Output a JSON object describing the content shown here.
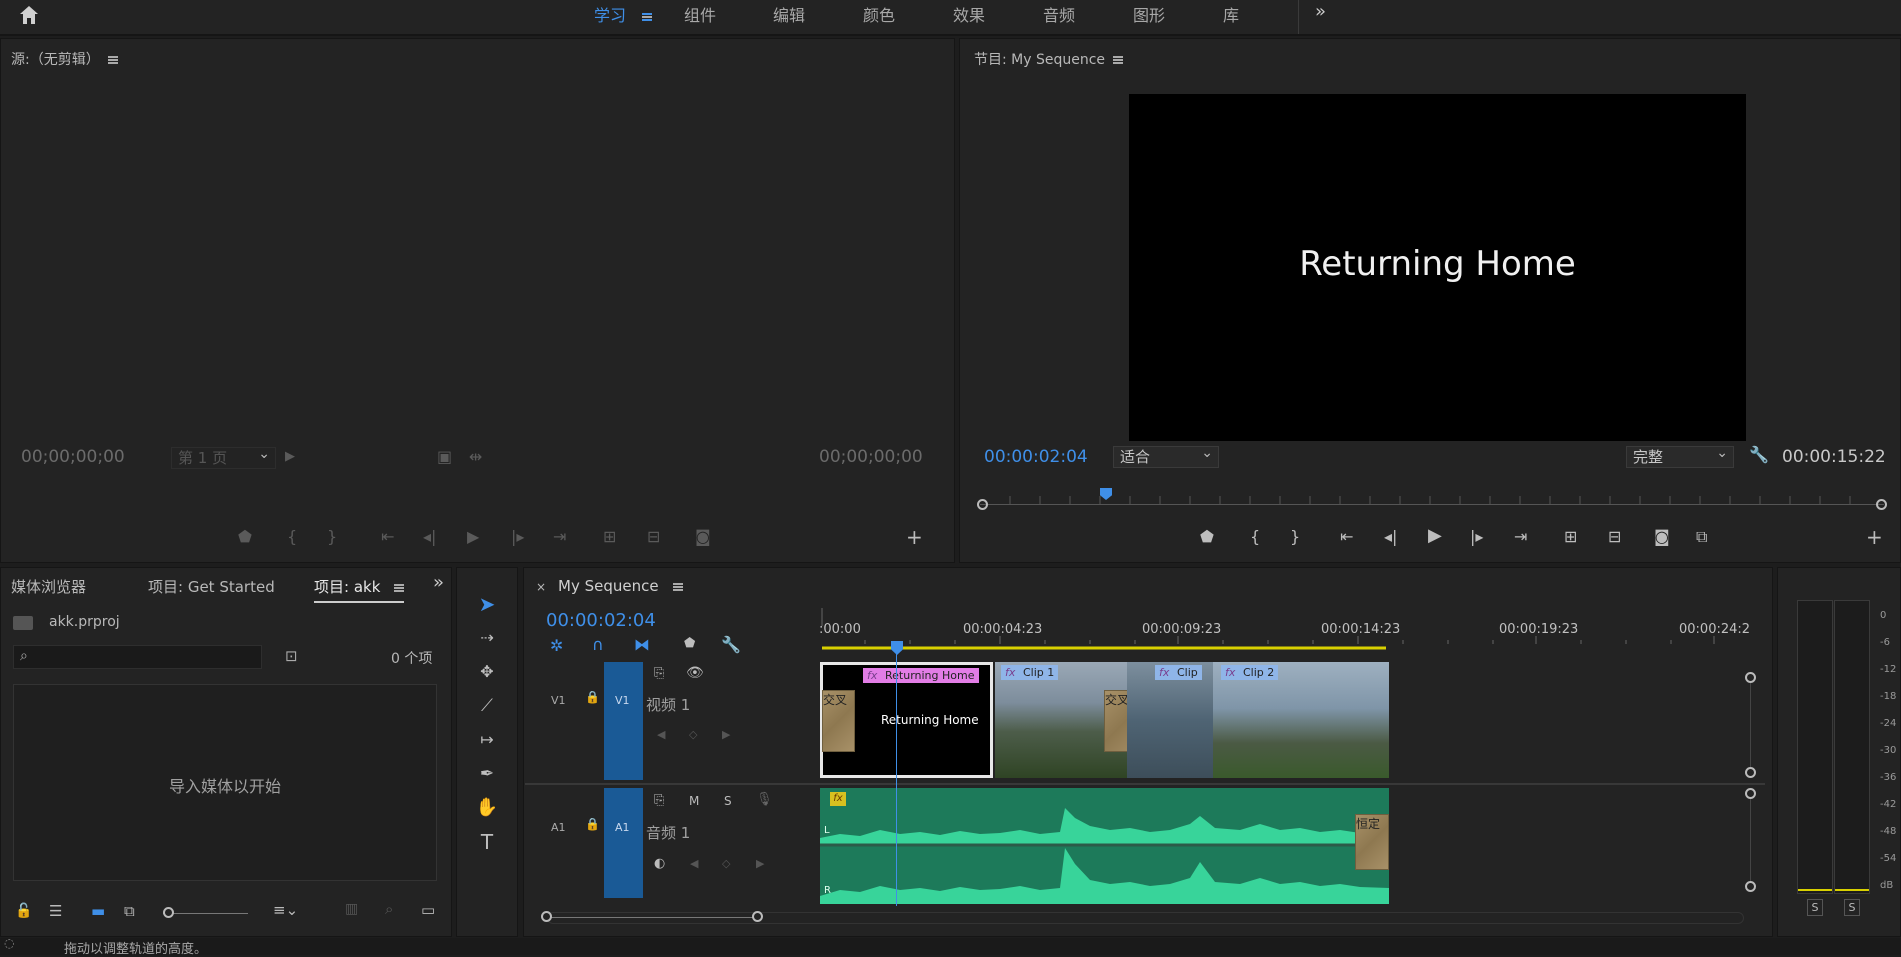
{
  "workspaces": [
    "学习",
    "组件",
    "编辑",
    "颜色",
    "效果",
    "音频",
    "图形",
    "库"
  ],
  "active_workspace": "学习",
  "source": {
    "title": "源:（无剪辑）",
    "tc_left": "00;00;00;00",
    "tc_right": "00;00;00;00",
    "page_select": "第 1 页"
  },
  "program": {
    "title": "节目: My Sequence",
    "title_card": "Returning Home",
    "tc_current": "00:00:02:04",
    "fit": "适合",
    "quality": "完整",
    "tc_duration": "00:00:15:22"
  },
  "project": {
    "tabs": [
      "媒体浏览器",
      "项目: Get Started",
      "项目: akk"
    ],
    "file": "akk.prproj",
    "item_count": "0 个项",
    "empty_hint": "导入媒体以开始"
  },
  "timeline": {
    "tab": "My Sequence",
    "tc": "00:00:02:04",
    "ruler": [
      ":00:00",
      "00:00:04:23",
      "00:00:09:23",
      "00:00:14:23",
      "00:00:19:23",
      "00:00:24:2"
    ],
    "video_track": {
      "id": "V1",
      "name": "视频 1"
    },
    "audio_track": {
      "id": "A1",
      "name": "音频 1",
      "m": "M",
      "s": "S"
    },
    "clips": [
      {
        "label": "Returning Home",
        "color": "#e27de6"
      },
      {
        "label": "Clip 1",
        "color": "#8fb5e8"
      },
      {
        "label": "Clip",
        "color": "#8fb5e8"
      },
      {
        "label": "Clip 2",
        "color": "#8fb5e8"
      }
    ],
    "clip_title_text": "Returning Home",
    "transitions": [
      "交叉",
      "交叉溶",
      "恒定"
    ],
    "audio_lr": [
      "L",
      "R"
    ],
    "fx": "fx"
  },
  "meter": {
    "scale": [
      "0",
      "-6",
      "-12",
      "-18",
      "-24",
      "-30",
      "-36",
      "-42",
      "-48",
      "-54",
      "dB"
    ],
    "solo": [
      "S",
      "S"
    ]
  },
  "status": "拖动以调整轨道的高度。"
}
